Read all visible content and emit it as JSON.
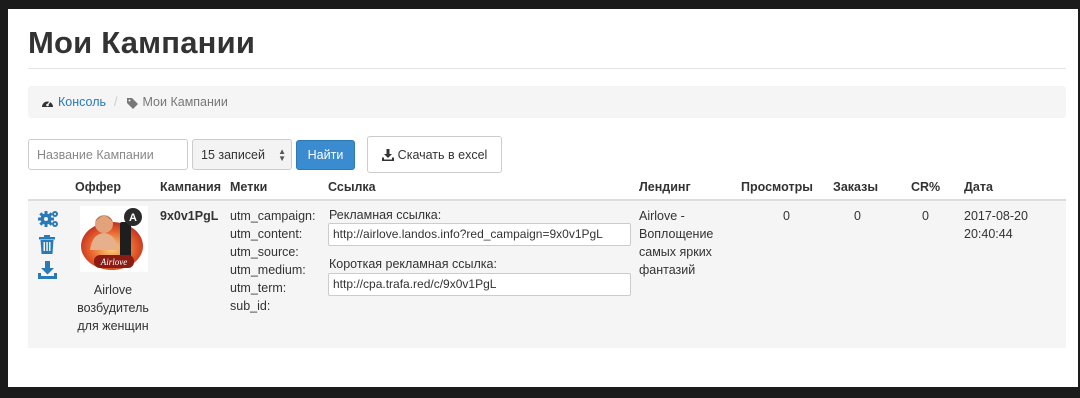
{
  "page": {
    "title": "Мои Кампании"
  },
  "breadcrumb": {
    "home_label": "Консоль",
    "current_label": "Мои Кампании"
  },
  "toolbar": {
    "search_placeholder": "Название Кампании",
    "per_page_value": "15 записей",
    "find_label": "Найти",
    "excel_label": "Скачать в excel"
  },
  "table": {
    "headers": {
      "offer": "Оффер",
      "campaign": "Кампания",
      "tags": "Метки",
      "link": "Ссылка",
      "landing": "Лендинг",
      "views": "Просмотры",
      "orders": "Заказы",
      "cr": "CR%",
      "date": "Дата"
    },
    "row": {
      "offer_name_lines": [
        "Airlove",
        "возбудитель",
        "для женщин"
      ],
      "offer_image_caption": "Airlove",
      "campaign": "9x0v1PgL",
      "tags": [
        "utm_campaign:",
        "utm_content:",
        "utm_source:",
        "utm_medium:",
        "utm_term:",
        "sub_id:"
      ],
      "ad_link_label": "Рекламная ссылка:",
      "ad_link_value": "http://airlove.landos.info?red_campaign=9x0v1PgL",
      "short_link_label": "Короткая рекламная ссылка:",
      "short_link_value": "http://cpa.trafa.red/c/9x0v1PgL",
      "landing_lines": [
        "Airlove -",
        "Воплощение",
        "самых ярких",
        "фантазий"
      ],
      "views": "0",
      "orders": "0",
      "cr": "0",
      "date_line1": "2017-08-20",
      "date_line2": "20:40:44"
    }
  },
  "colors": {
    "accent": "#3a8bd0",
    "link": "#2a7ab8",
    "frame": "#1b1b1b"
  },
  "icons": [
    "dashboard-icon",
    "tag-icon",
    "download-icon",
    "settings-icon",
    "trash-icon",
    "download-action-icon"
  ]
}
